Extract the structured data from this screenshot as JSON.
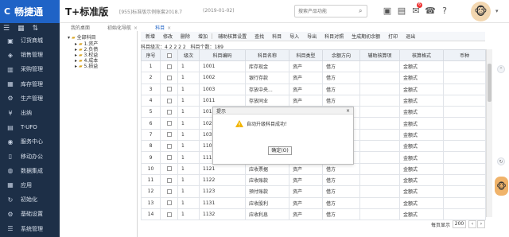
{
  "brand": {
    "logo_text": "畅捷通",
    "logo_mark": "C",
    "edition": "T+标准版"
  },
  "header": {
    "company": "[955]标准版示例账套2018.7",
    "date": "(2019-01-02)",
    "search_placeholder": "搜索产品功能"
  },
  "header_icons": [
    {
      "name": "calculator-icon",
      "glyph": "▣"
    },
    {
      "name": "document-icon",
      "glyph": "▤"
    },
    {
      "name": "bell-icon",
      "glyph": "✉",
      "badge": "6"
    },
    {
      "name": "phone-icon",
      "glyph": "☎"
    },
    {
      "name": "help-icon",
      "glyph": "?"
    }
  ],
  "sidebar": {
    "items": [
      {
        "label": "订货商城",
        "icon": "store-icon",
        "glyph": "▣"
      },
      {
        "label": "销售管理",
        "icon": "sales-icon",
        "glyph": "◈"
      },
      {
        "label": "采购管理",
        "icon": "purchase-icon",
        "glyph": "▥"
      },
      {
        "label": "库存管理",
        "icon": "inventory-icon",
        "glyph": "▦"
      },
      {
        "label": "生产管理",
        "icon": "production-icon",
        "glyph": "⚙"
      },
      {
        "label": "出纳",
        "icon": "cashier-icon",
        "glyph": "¥"
      },
      {
        "label": "T-UFO",
        "icon": "ufo-icon",
        "glyph": "▤"
      },
      {
        "label": "服务中心",
        "icon": "service-icon",
        "glyph": "◉"
      },
      {
        "label": "移动办公",
        "icon": "mobile-icon",
        "glyph": "▯"
      },
      {
        "label": "数据集成",
        "icon": "data-icon",
        "glyph": "◍"
      },
      {
        "label": "应用",
        "icon": "apps-icon",
        "glyph": "▦"
      },
      {
        "label": "初始化",
        "icon": "init-icon",
        "glyph": "↻"
      },
      {
        "label": "基础设置",
        "icon": "settings-icon",
        "glyph": "⚙"
      },
      {
        "label": "系统管理",
        "icon": "system-icon",
        "glyph": "☰"
      }
    ]
  },
  "tabs": [
    {
      "label": "我的桌面",
      "closable": false
    },
    {
      "label": "初始化导航",
      "closable": true
    },
    {
      "label": "科目",
      "closable": true,
      "active": true
    }
  ],
  "tree": {
    "root": "全部科目",
    "nodes": [
      "1.资产",
      "2.负债",
      "3.权益",
      "4.成本",
      "5.损益"
    ]
  },
  "toolbar": {
    "buttons": [
      "新增",
      "修改",
      "删除",
      "增加",
      "辅助核算设置",
      "查找",
      "科目",
      "导入",
      "导出",
      "科目对照",
      "生成期初余额",
      "打印",
      "退出"
    ]
  },
  "stats": {
    "level": "科目级次：4 2 2 2 2",
    "count": "科目个数：189"
  },
  "grid": {
    "headers": [
      "序号",
      "",
      "级次",
      "科目编码",
      "科目名称",
      "科目类型",
      "余额方向",
      "辅助核算项",
      "核算格式",
      "币种"
    ],
    "rows": [
      {
        "no": "1",
        "level": "1",
        "code": "1001",
        "name": "库存现金",
        "type": "资产",
        "dir": "借方",
        "aux": "",
        "format": "金额式",
        "currency": ""
      },
      {
        "no": "2",
        "level": "1",
        "code": "1002",
        "name": "银行存款",
        "type": "资产",
        "dir": "借方",
        "aux": "",
        "format": "金额式",
        "currency": ""
      },
      {
        "no": "3",
        "level": "1",
        "code": "1003",
        "name": "存放中央...",
        "type": "资产",
        "dir": "借方",
        "aux": "",
        "format": "金额式",
        "currency": ""
      },
      {
        "no": "4",
        "level": "1",
        "code": "1011",
        "name": "存放同业",
        "type": "资产",
        "dir": "借方",
        "aux": "",
        "format": "金额式",
        "currency": ""
      },
      {
        "no": "5",
        "level": "1",
        "code": "1012",
        "name": "",
        "type": "",
        "dir": "",
        "aux": "",
        "format": "金额式",
        "currency": ""
      },
      {
        "no": "6",
        "level": "1",
        "code": "1021",
        "name": "",
        "type": "",
        "dir": "",
        "aux": "",
        "format": "金额式",
        "currency": ""
      },
      {
        "no": "7",
        "level": "1",
        "code": "1031",
        "name": "",
        "type": "",
        "dir": "",
        "aux": "",
        "format": "金额式",
        "currency": ""
      },
      {
        "no": "8",
        "level": "1",
        "code": "1101",
        "name": "",
        "type": "",
        "dir": "",
        "aux": "",
        "format": "金额式",
        "currency": ""
      },
      {
        "no": "9",
        "level": "1",
        "code": "1111",
        "name": "",
        "type": "",
        "dir": "",
        "aux": "",
        "format": "金额式",
        "currency": ""
      },
      {
        "no": "10",
        "level": "1",
        "code": "1121",
        "name": "应收票据",
        "type": "资产",
        "dir": "借方",
        "aux": "",
        "format": "金额式",
        "currency": ""
      },
      {
        "no": "11",
        "level": "1",
        "code": "1122",
        "name": "应收账款",
        "type": "资产",
        "dir": "借方",
        "aux": "",
        "format": "金额式",
        "currency": ""
      },
      {
        "no": "12",
        "level": "1",
        "code": "1123",
        "name": "预付账款",
        "type": "资产",
        "dir": "借方",
        "aux": "",
        "format": "金额式",
        "currency": ""
      },
      {
        "no": "13",
        "level": "1",
        "code": "1131",
        "name": "应收股利",
        "type": "资产",
        "dir": "借方",
        "aux": "",
        "format": "金额式",
        "currency": ""
      },
      {
        "no": "14",
        "level": "1",
        "code": "1132",
        "name": "应收利息",
        "type": "资产",
        "dir": "借方",
        "aux": "",
        "format": "金额式",
        "currency": ""
      }
    ]
  },
  "pager": {
    "label": "每页显示",
    "page_size": "200"
  },
  "dialog": {
    "title": "提示",
    "message": "自动升级科目成功！",
    "ok_label": "确定(O)"
  },
  "colors": {
    "primary": "#1f63c6",
    "sidebar": "#1d2f47"
  }
}
